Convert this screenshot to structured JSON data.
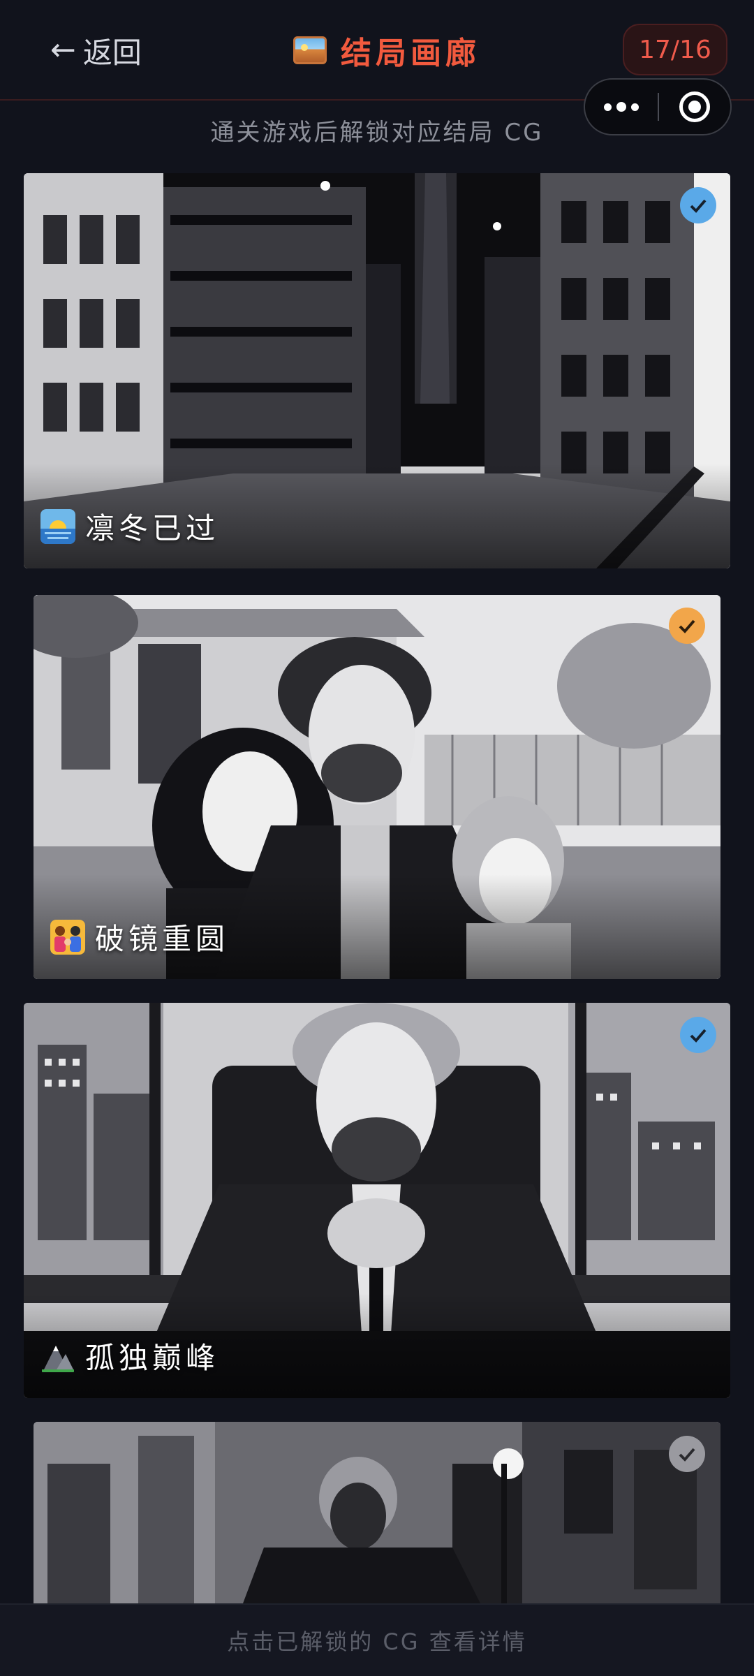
{
  "header": {
    "back_icon": "arrow-left-icon",
    "back_label": "返回",
    "title_icon": "picture-icon",
    "title": "结局画廊",
    "counter": "17/16"
  },
  "capsule": {
    "more_icon": "more-dots-icon",
    "close_icon": "record-circle-icon"
  },
  "subtitle": "通关游戏后解锁对应结局 CG",
  "endings": [
    {
      "name": "凛冬已过",
      "emoji_icon": "sunrise-icon",
      "check_icon": "check-icon",
      "check_color": "#5aa9e8"
    },
    {
      "name": "破镜重圆",
      "emoji_icon": "family-icon",
      "check_icon": "check-icon",
      "check_color": "#f2a64a"
    },
    {
      "name": "孤独巅峰",
      "emoji_icon": "mountain-icon",
      "check_icon": "check-icon",
      "check_color": "#5aa9e8"
    },
    {
      "name": "",
      "emoji_icon": "",
      "check_icon": "check-icon",
      "check_color": "#9a9aa0"
    }
  ],
  "footer": "点击已解锁的 CG 查看详情",
  "colors": {
    "background": "#11131c",
    "accent": "#f25a3e",
    "text_muted": "#8d909a"
  }
}
